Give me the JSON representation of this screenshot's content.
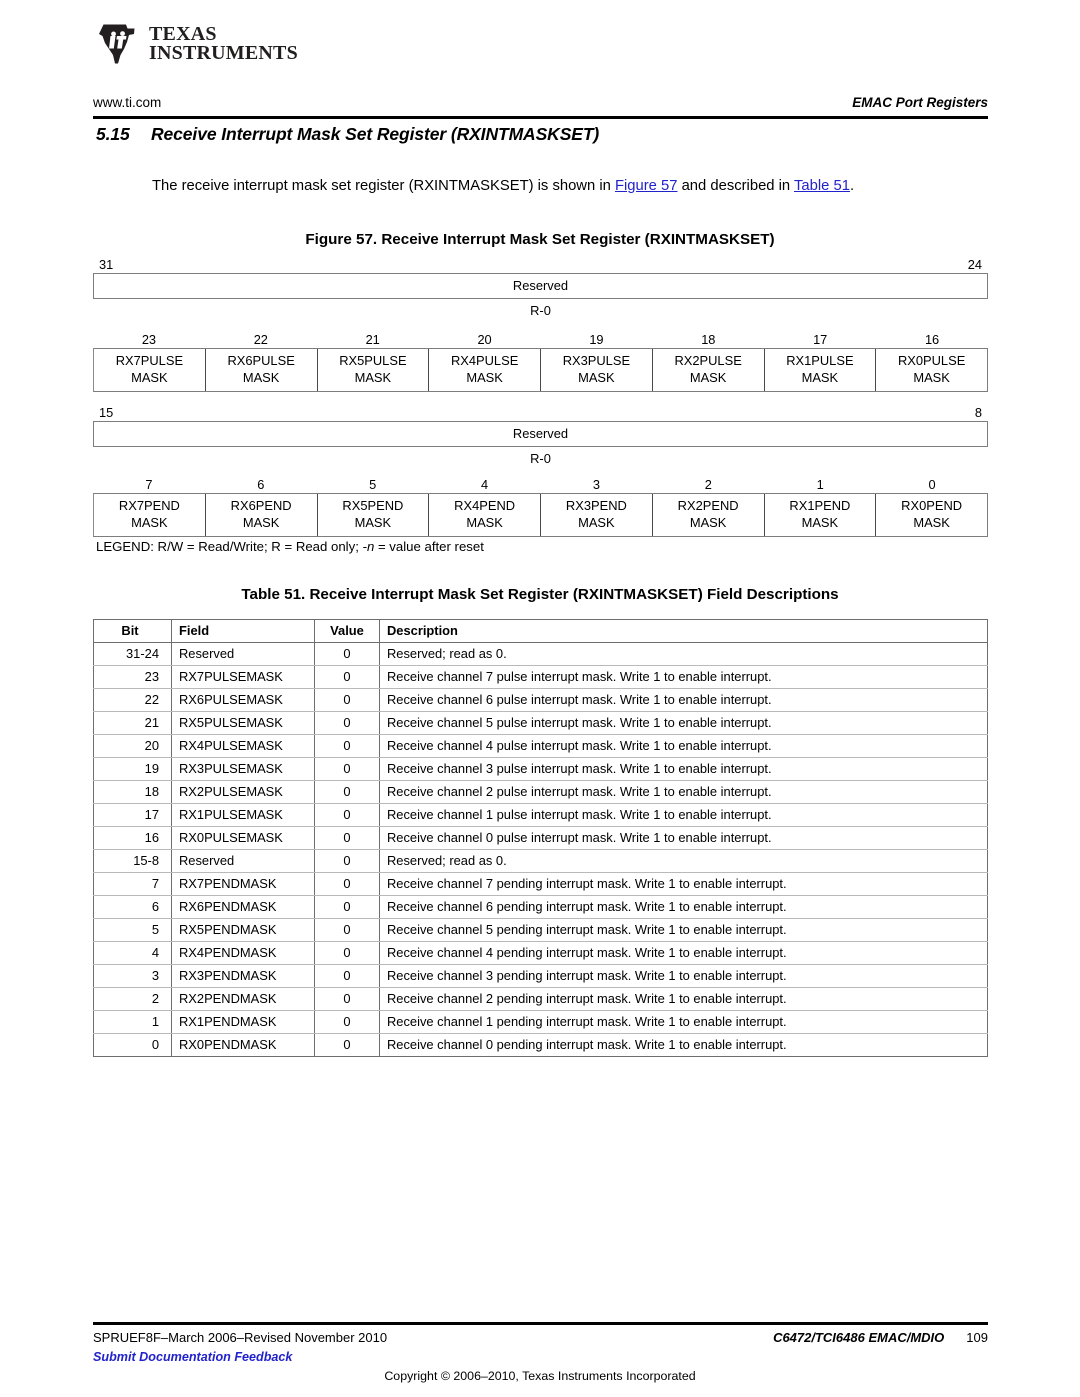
{
  "header": {
    "logo_line1": "TEXAS",
    "logo_line2": "INSTRUMENTS",
    "url": "www.ti.com",
    "section": "EMAC Port Registers"
  },
  "section": {
    "number": "5.15",
    "title": "Receive Interrupt Mask Set Register (RXINTMASKSET)",
    "intro_1": "The receive interrupt mask set register (RXINTMASKSET) is shown in ",
    "intro_link_figure": "Figure 57",
    "intro_2": " and described in",
    "intro_link_table": "Table 51",
    "intro_3": "."
  },
  "figure": {
    "caption": "Figure 57. Receive Interrupt Mask Set Register (RXINTMASKSET)",
    "row1": {
      "bit_high": "31",
      "bit_low": "24",
      "label": "Reserved",
      "access": "R-0"
    },
    "row2": {
      "bits": [
        "23",
        "22",
        "21",
        "20",
        "19",
        "18",
        "17",
        "16"
      ],
      "cells": [
        {
          "top": "RX7PULSE",
          "bottom": "MASK"
        },
        {
          "top": "RX6PULSE",
          "bottom": "MASK"
        },
        {
          "top": "RX5PULSE",
          "bottom": "MASK"
        },
        {
          "top": "RX4PULSE",
          "bottom": "MASK"
        },
        {
          "top": "RX3PULSE",
          "bottom": "MASK"
        },
        {
          "top": "RX2PULSE",
          "bottom": "MASK"
        },
        {
          "top": "RX1PULSE",
          "bottom": "MASK"
        },
        {
          "top": "RX0PULSE",
          "bottom": "MASK"
        }
      ]
    },
    "row3": {
      "bit_high": "15",
      "bit_low": "8",
      "label": "Reserved",
      "access": "R-0"
    },
    "row4": {
      "bits": [
        "7",
        "6",
        "5",
        "4",
        "3",
        "2",
        "1",
        "0"
      ],
      "cells": [
        {
          "top": "RX7PEND",
          "bottom": "MASK"
        },
        {
          "top": "RX6PEND",
          "bottom": "MASK"
        },
        {
          "top": "RX5PEND",
          "bottom": "MASK"
        },
        {
          "top": "RX4PEND",
          "bottom": "MASK"
        },
        {
          "top": "RX3PEND",
          "bottom": "MASK"
        },
        {
          "top": "RX2PEND",
          "bottom": "MASK"
        },
        {
          "top": "RX1PEND",
          "bottom": "MASK"
        },
        {
          "top": "RX0PEND",
          "bottom": "MASK"
        }
      ]
    },
    "legend_pre": "LEGEND: R/W = Read/Write; R = Read only; ",
    "legend_italic": "-n",
    "legend_post": " = value after reset"
  },
  "table": {
    "caption": "Table 51. Receive Interrupt Mask Set Register (RXINTMASKSET) Field Descriptions",
    "columns": [
      "Bit",
      "Field",
      "Value",
      "Description"
    ],
    "rows": [
      {
        "bit": "31-24",
        "field": "Reserved",
        "value": "0",
        "desc": "Reserved; read as 0."
      },
      {
        "bit": "23",
        "field": "RX7PULSEMASK",
        "value": "0",
        "desc": "Receive channel 7 pulse interrupt mask. Write 1 to enable interrupt."
      },
      {
        "bit": "22",
        "field": "RX6PULSEMASK",
        "value": "0",
        "desc": "Receive channel 6 pulse interrupt mask. Write 1 to enable interrupt."
      },
      {
        "bit": "21",
        "field": "RX5PULSEMASK",
        "value": "0",
        "desc": "Receive channel 5 pulse interrupt mask. Write 1 to enable interrupt."
      },
      {
        "bit": "20",
        "field": "RX4PULSEMASK",
        "value": "0",
        "desc": "Receive channel 4 pulse interrupt mask. Write 1 to enable interrupt."
      },
      {
        "bit": "19",
        "field": "RX3PULSEMASK",
        "value": "0",
        "desc": "Receive channel 3 pulse interrupt mask. Write 1 to enable interrupt."
      },
      {
        "bit": "18",
        "field": "RX2PULSEMASK",
        "value": "0",
        "desc": "Receive channel 2 pulse interrupt mask. Write 1 to enable interrupt."
      },
      {
        "bit": "17",
        "field": "RX1PULSEMASK",
        "value": "0",
        "desc": "Receive channel 1 pulse interrupt mask. Write 1 to enable interrupt."
      },
      {
        "bit": "16",
        "field": "RX0PULSEMASK",
        "value": "0",
        "desc": "Receive channel 0 pulse interrupt mask. Write 1 to enable interrupt."
      },
      {
        "bit": "15-8",
        "field": "Reserved",
        "value": "0",
        "desc": "Reserved; read as 0."
      },
      {
        "bit": "7",
        "field": "RX7PENDMASK",
        "value": "0",
        "desc": "Receive channel 7 pending interrupt mask. Write 1 to enable interrupt."
      },
      {
        "bit": "6",
        "field": "RX6PENDMASK",
        "value": "0",
        "desc": "Receive channel 6 pending interrupt mask. Write 1 to enable interrupt."
      },
      {
        "bit": "5",
        "field": "RX5PENDMASK",
        "value": "0",
        "desc": "Receive channel 5 pending interrupt mask. Write 1 to enable interrupt."
      },
      {
        "bit": "4",
        "field": "RX4PENDMASK",
        "value": "0",
        "desc": "Receive channel 4 pending interrupt mask. Write 1 to enable interrupt."
      },
      {
        "bit": "3",
        "field": "RX3PENDMASK",
        "value": "0",
        "desc": "Receive channel 3 pending interrupt mask. Write 1 to enable interrupt."
      },
      {
        "bit": "2",
        "field": "RX2PENDMASK",
        "value": "0",
        "desc": "Receive channel 2 pending interrupt mask. Write 1 to enable interrupt."
      },
      {
        "bit": "1",
        "field": "RX1PENDMASK",
        "value": "0",
        "desc": "Receive channel 1 pending interrupt mask. Write 1 to enable interrupt."
      },
      {
        "bit": "0",
        "field": "RX0PENDMASK",
        "value": "0",
        "desc": "Receive channel 0 pending interrupt mask. Write 1 to enable interrupt."
      }
    ]
  },
  "footer": {
    "doc_id": "SPRUEF8F–March 2006–Revised November 2010",
    "device": "C6472/TCI6486 EMAC/MDIO",
    "page": "109",
    "feedback": "Submit Documentation Feedback",
    "copyright": "Copyright © 2006–2010, Texas Instruments Incorporated"
  },
  "colors": {
    "link": "#2222cc",
    "rule": "#000000",
    "cell_border": "#6e6e6e"
  }
}
